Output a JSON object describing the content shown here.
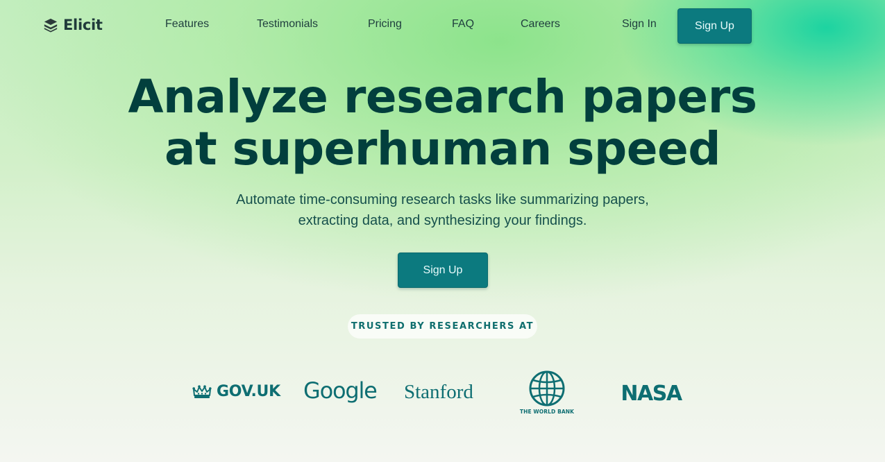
{
  "brand": {
    "name": "Elicit",
    "logo_icon": "stacked-layers-icon",
    "accent_color": "#0c7a7f",
    "heading_color": "#023f3d"
  },
  "nav": {
    "links": [
      {
        "label": "Features"
      },
      {
        "label": "Testimonials"
      },
      {
        "label": "Pricing"
      },
      {
        "label": "FAQ"
      },
      {
        "label": "Careers"
      }
    ],
    "sign_in_label": "Sign In",
    "sign_up_label": "Sign Up"
  },
  "hero": {
    "headline_line1": "Analyze research papers",
    "headline_line2": "at superhuman speed",
    "subtitle_line1": "Automate time-consuming research tasks like summarizing papers,",
    "subtitle_line2": "extracting data, and synthesizing your findings.",
    "cta_label": "Sign Up"
  },
  "trusted": {
    "label": "TRUSTED BY RESEARCHERS AT",
    "logos": [
      {
        "text": "GOV.UK",
        "icon": "crown-icon"
      },
      {
        "text": "Google"
      },
      {
        "text": "Stanford"
      },
      {
        "text": "THE WORLD BANK",
        "icon": "globe-icon"
      },
      {
        "text": "NASA",
        "icon": "nasa-worm-logo"
      }
    ]
  }
}
